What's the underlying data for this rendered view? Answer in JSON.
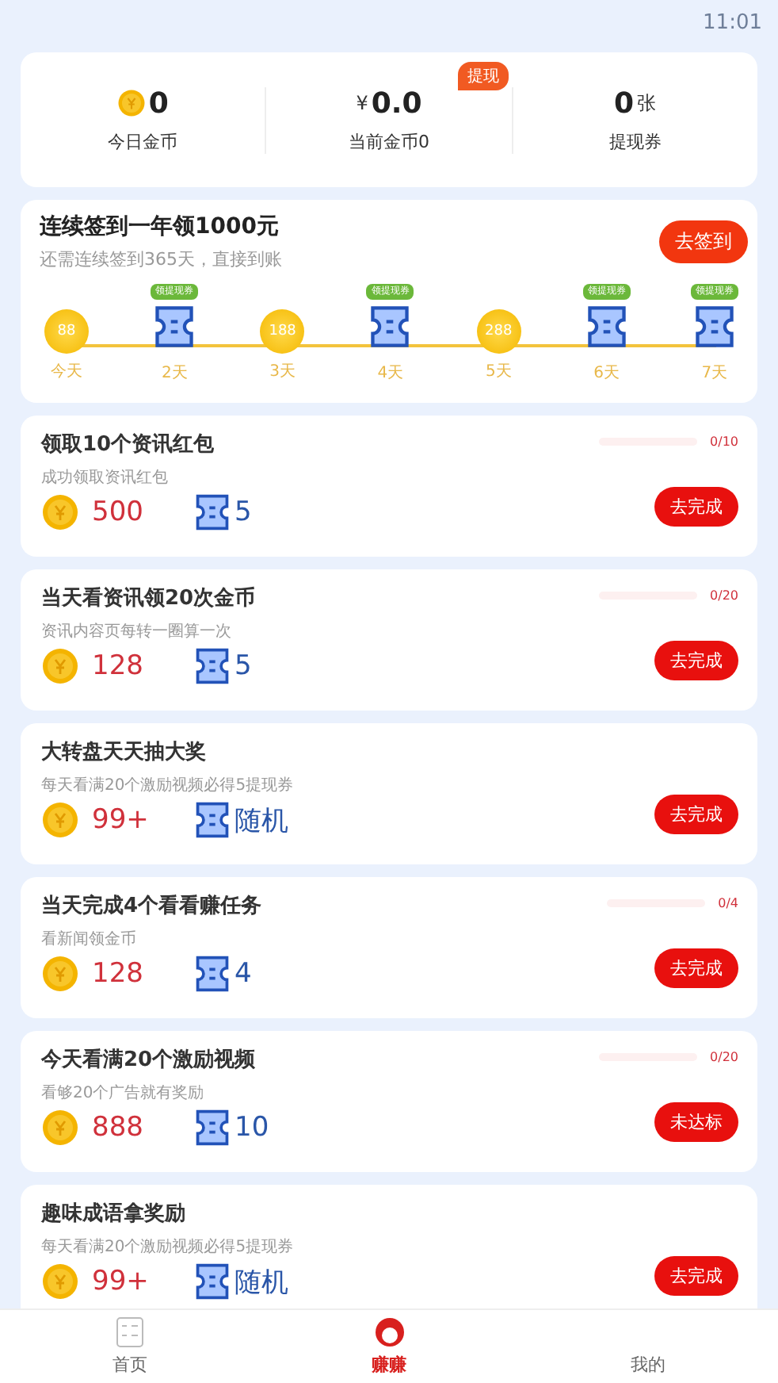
{
  "status_bar": {
    "time": "11:01"
  },
  "summary": {
    "badge": "提现",
    "stats": [
      {
        "kind": "coin",
        "value": "0",
        "label": "今日金币"
      },
      {
        "kind": "money",
        "prefix": "¥",
        "value": "0.0",
        "label": "当前金币0"
      },
      {
        "kind": "voucher",
        "value": "0",
        "unit": "张",
        "label": "提现券"
      }
    ]
  },
  "signin": {
    "title": "连续签到一年领1000元",
    "subtitle": "还需连续签到365天，直接到账",
    "button": "去签到",
    "days": [
      {
        "kind": "coin",
        "amount": "88",
        "label": "今天"
      },
      {
        "kind": "voucher",
        "tag": "领提现券",
        "label": "2天"
      },
      {
        "kind": "coin",
        "amount": "188",
        "label": "3天"
      },
      {
        "kind": "voucher",
        "tag": "领提现券",
        "label": "4天"
      },
      {
        "kind": "coin",
        "amount": "288",
        "label": "5天"
      },
      {
        "kind": "voucher",
        "tag": "领提现券",
        "label": "6天"
      },
      {
        "kind": "voucher",
        "tag": "领提现券",
        "label": "7天"
      }
    ]
  },
  "tasks": [
    {
      "title": "领取10个资讯红包",
      "desc": "成功领取资讯红包",
      "progress": "0/10",
      "level": 0,
      "coins": "500",
      "vouchers": "5",
      "button": "去完成"
    },
    {
      "title": "当天看资讯领20次金币",
      "desc": "资讯内容页每转一圈算一次",
      "progress": "0/20",
      "level": 0,
      "coins": "128",
      "vouchers": "5",
      "button": "去完成"
    },
    {
      "title": "大转盘天天抽大奖",
      "desc": "每天看满20个激励视频必得5提现券",
      "coins": "99+",
      "vouchers": "随机",
      "button": "去完成"
    },
    {
      "title": "当天完成4个看看赚任务",
      "desc": "看新闻领金币",
      "progress": "0/4",
      "level": 0,
      "coins": "128",
      "vouchers": "4",
      "button": "去完成"
    },
    {
      "title": "今天看满20个激励视频",
      "desc": "看够20个广告就有奖励",
      "progress": "0/20",
      "level": 0,
      "coins": "888",
      "vouchers": "10",
      "button": "未达标"
    },
    {
      "title": "趣味成语拿奖励",
      "desc": "每天看满20个激励视频必得5提现券",
      "coins": "99+",
      "vouchers": "随机",
      "button": "去完成"
    }
  ],
  "nav": [
    {
      "kind": "home",
      "label": "首页",
      "selected": false
    },
    {
      "kind": "earn",
      "label": "赚赚",
      "selected": true
    },
    {
      "kind": "me",
      "label": "我的",
      "selected": false
    }
  ]
}
